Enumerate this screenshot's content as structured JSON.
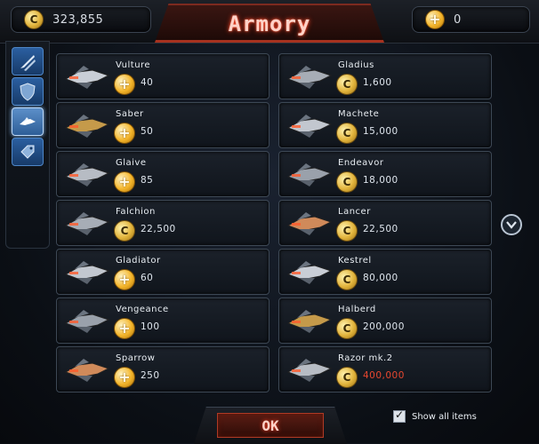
{
  "header": {
    "title": "Armory",
    "credits": "323,855",
    "gold": "0"
  },
  "sidebar": {
    "tabs": [
      {
        "icon": "weapons-icon",
        "active": false
      },
      {
        "icon": "shield-icon",
        "active": false
      },
      {
        "icon": "ship-icon",
        "active": true
      },
      {
        "icon": "tag-icon",
        "active": false
      }
    ]
  },
  "items_left": [
    {
      "name": "Vulture",
      "price": "40",
      "currency": "gold"
    },
    {
      "name": "Saber",
      "price": "50",
      "currency": "gold"
    },
    {
      "name": "Glaive",
      "price": "85",
      "currency": "gold"
    },
    {
      "name": "Falchion",
      "price": "22,500",
      "currency": "credit"
    },
    {
      "name": "Gladiator",
      "price": "60",
      "currency": "gold"
    },
    {
      "name": "Vengeance",
      "price": "100",
      "currency": "gold"
    },
    {
      "name": "Sparrow",
      "price": "250",
      "currency": "gold"
    }
  ],
  "items_right": [
    {
      "name": "Gladius",
      "price": "1,600",
      "currency": "credit"
    },
    {
      "name": "Machete",
      "price": "15,000",
      "currency": "credit"
    },
    {
      "name": "Endeavor",
      "price": "18,000",
      "currency": "credit"
    },
    {
      "name": "Lancer",
      "price": "22,500",
      "currency": "credit"
    },
    {
      "name": "Kestrel",
      "price": "80,000",
      "currency": "credit"
    },
    {
      "name": "Halberd",
      "price": "200,000",
      "currency": "credit"
    },
    {
      "name": "Razor mk.2",
      "price": "400,000",
      "currency": "credit",
      "unaffordable": true
    }
  ],
  "footer": {
    "ok_label": "OK",
    "show_all_label": "Show all items",
    "show_all_checked": true
  },
  "colors": {
    "accent_red": "#e7472f",
    "tab_blue": "#2b5fa0",
    "title_glow": "#ff3b1e"
  }
}
